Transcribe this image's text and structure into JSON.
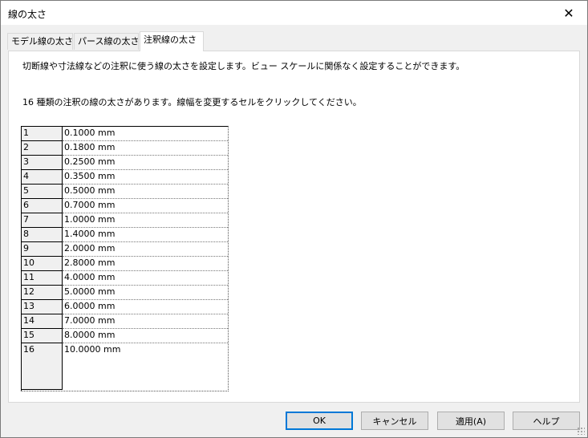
{
  "window": {
    "title": "線の太さ",
    "close_symbol": "✕"
  },
  "tabs": [
    {
      "label": "モデル線の太さ",
      "active": false
    },
    {
      "label": "パース線の太さ",
      "active": false
    },
    {
      "label": "注釈線の太さ",
      "active": true
    }
  ],
  "panel": {
    "description": "切断線や寸法線などの注釈に使う線の太さを設定します。ビュー スケールに関係なく設定することができます。",
    "info": "16 種類の注釈の線の太さがあります。線幅を変更するセルをクリックしてください。"
  },
  "line_weights": [
    {
      "num": "1",
      "value": "0.1000 mm"
    },
    {
      "num": "2",
      "value": "0.1800 mm"
    },
    {
      "num": "3",
      "value": "0.2500 mm"
    },
    {
      "num": "4",
      "value": "0.3500 mm"
    },
    {
      "num": "5",
      "value": "0.5000 mm"
    },
    {
      "num": "6",
      "value": "0.7000 mm"
    },
    {
      "num": "7",
      "value": "1.0000 mm"
    },
    {
      "num": "8",
      "value": "1.4000 mm"
    },
    {
      "num": "9",
      "value": "2.0000 mm"
    },
    {
      "num": "10",
      "value": "2.8000 mm"
    },
    {
      "num": "11",
      "value": "4.0000 mm"
    },
    {
      "num": "12",
      "value": "5.0000 mm"
    },
    {
      "num": "13",
      "value": "6.0000 mm"
    },
    {
      "num": "14",
      "value": "7.0000 mm"
    },
    {
      "num": "15",
      "value": "8.0000 mm"
    },
    {
      "num": "16",
      "value": "10.0000 mm"
    }
  ],
  "buttons": {
    "ok": "OK",
    "cancel": "キャンセル",
    "apply": "適用(A)",
    "help": "ヘルプ"
  },
  "colors": {
    "default_button_border": "#0078d7",
    "background": "#f0f0f0"
  }
}
